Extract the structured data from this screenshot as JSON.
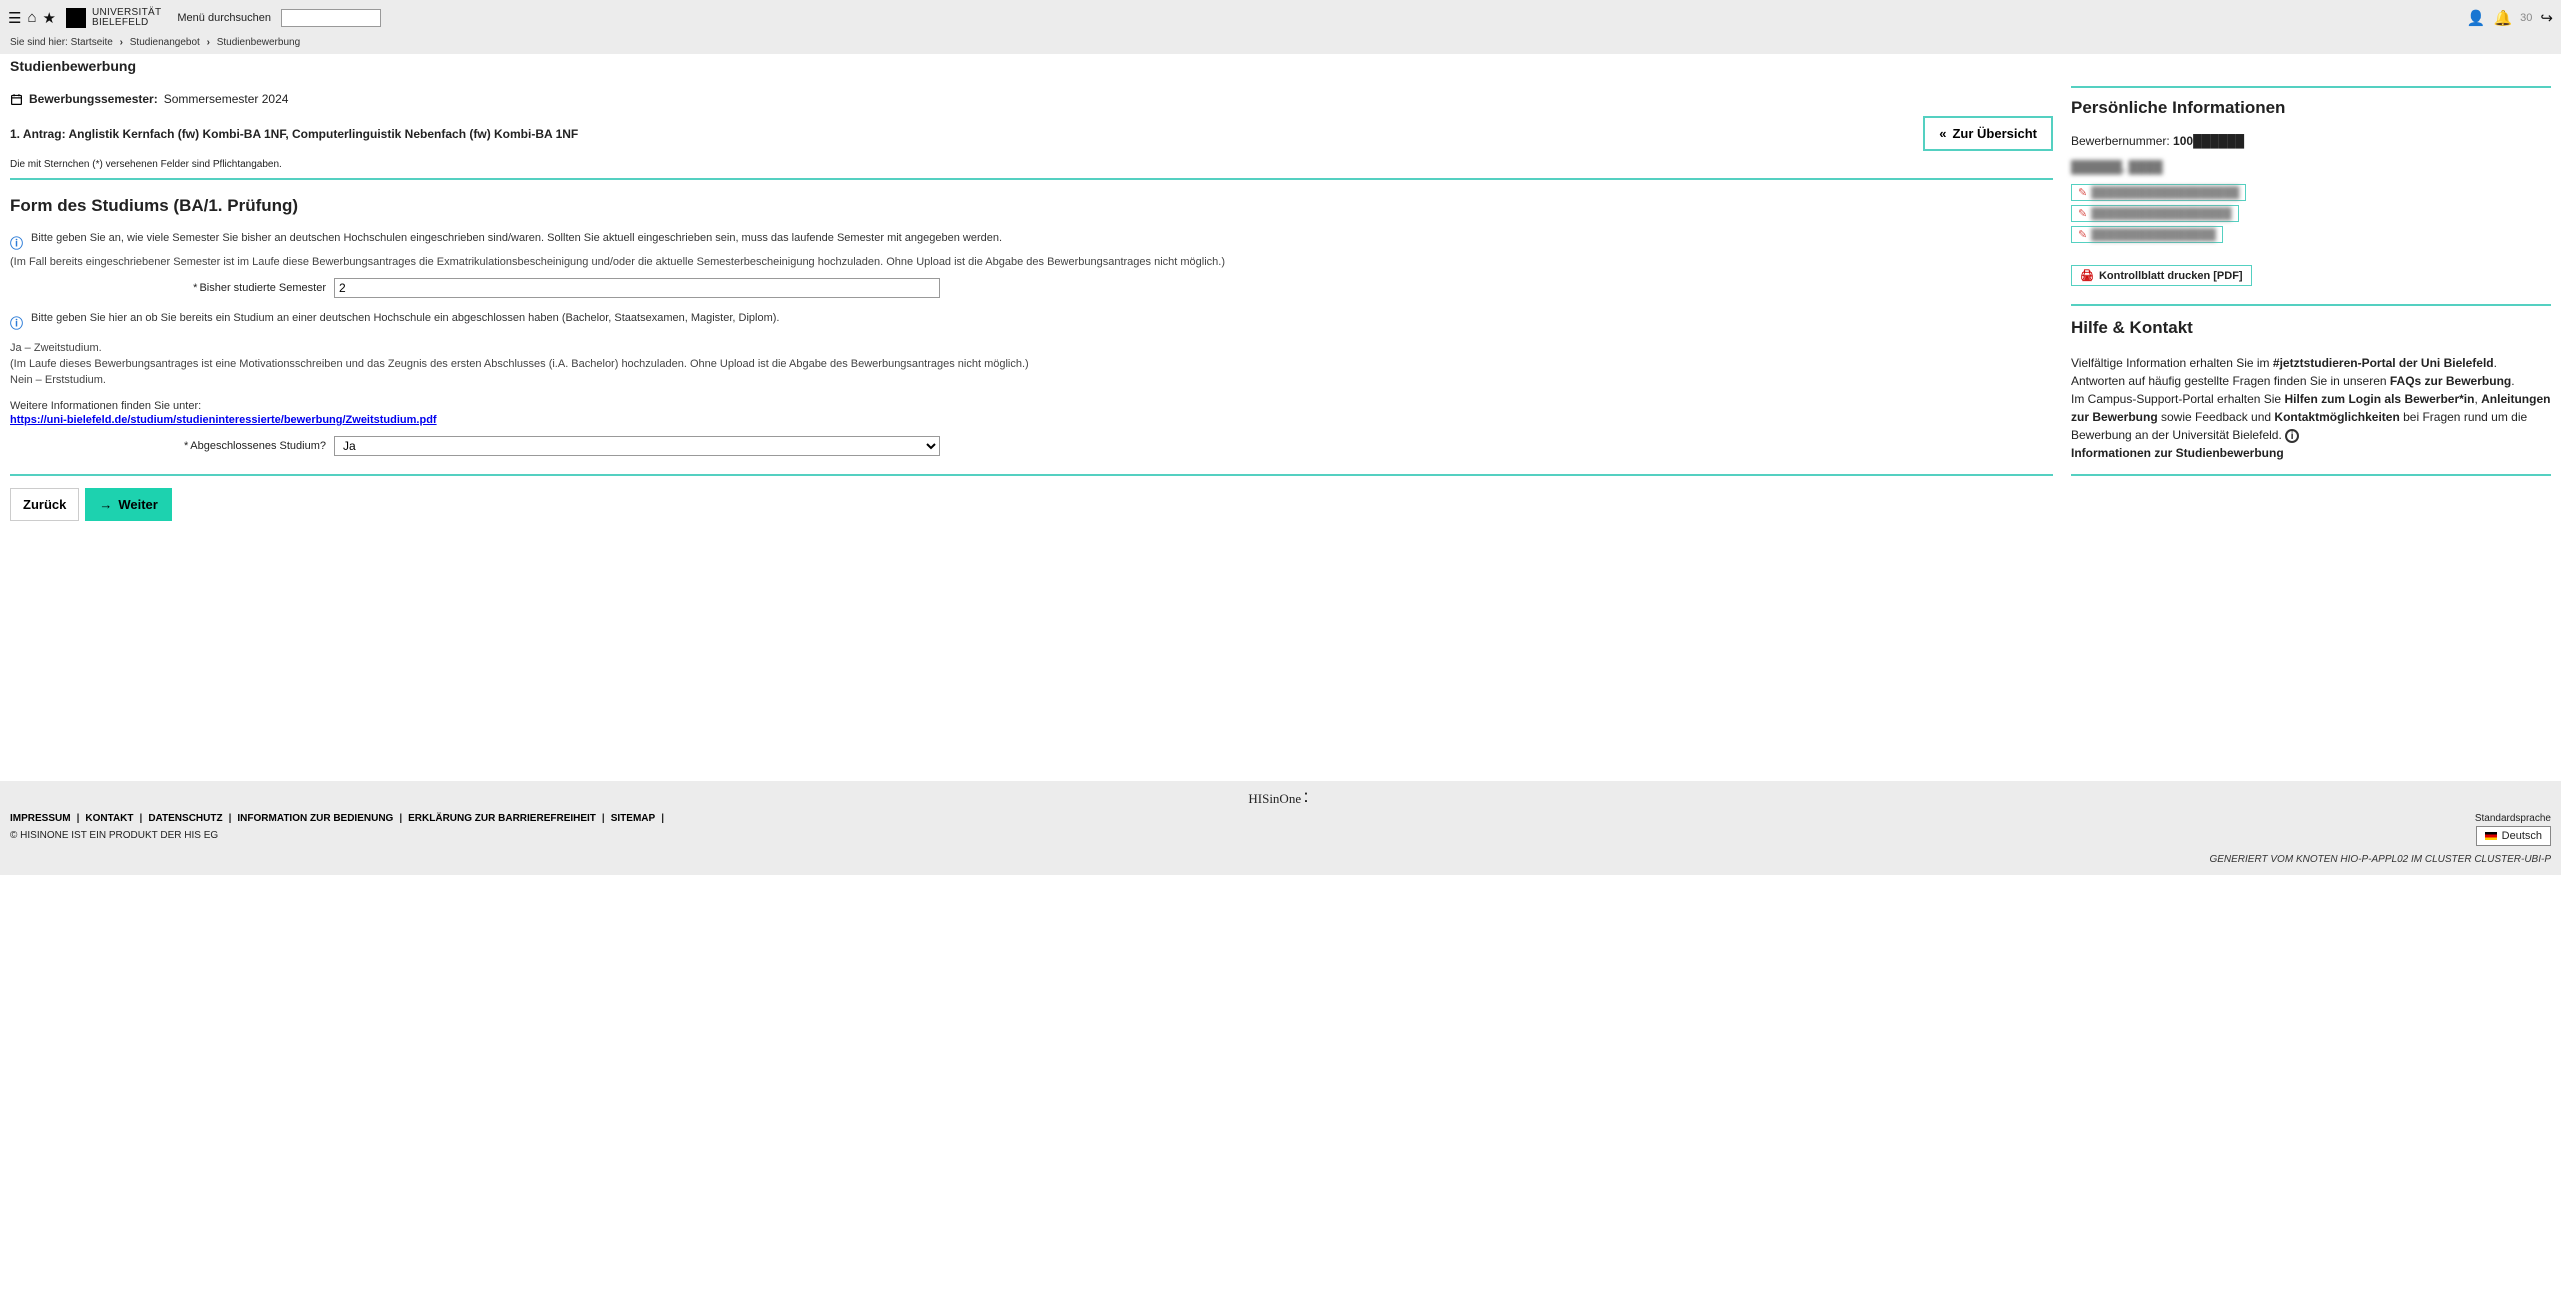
{
  "header": {
    "logo_line1": "UNIVERSITÄT",
    "logo_line2": "BIELEFELD",
    "search_label": "Menü durchsuchen",
    "notification_count": "30"
  },
  "breadcrumb": {
    "prefix": "Sie sind hier:",
    "items": [
      "Startseite",
      "Studienangebot",
      "Studienbewerbung"
    ]
  },
  "page_title": "Studienbewerbung",
  "semester": {
    "label": "Bewerbungssemester:",
    "value": "Sommersemester 2024"
  },
  "request": {
    "title": "1. Antrag: Anglistik Kernfach (fw) Kombi-BA 1NF, Computerlinguistik Nebenfach (fw) Kombi-BA 1NF",
    "overview_btn": "Zur Übersicht",
    "required_note": "Die mit Sternchen (*) versehenen Felder sind Pflichtangaben."
  },
  "section_title": "Form des Studiums (BA/1. Prüfung)",
  "info1": {
    "main": "Bitte geben Sie an, wie viele Semester Sie bisher an deutschen Hochschulen eingeschrieben sind/waren. Sollten Sie aktuell eingeschrieben sein, muss das laufende Semester mit angegeben werden.",
    "sub": "(Im Fall bereits eingeschriebener Semester ist im Laufe diese Bewerbungsantrages die Exmatrikulationsbescheinigung und/oder die aktuelle Semesterbescheinigung hochzuladen. Ohne Upload ist die Abgabe des Bewerbungsantrages nicht möglich.)"
  },
  "field_semester": {
    "label": "Bisher studierte Semester",
    "value": "2"
  },
  "info2": {
    "main": "Bitte geben Sie hier an ob Sie bereits ein Studium an einer deutschen Hochschule ein abgeschlossen haben (Bachelor, Staatsexamen, Magister, Diplom).",
    "line1": "Ja – Zweitstudium.",
    "line2": "(Im Laufe dieses Bewerbungsantrages ist eine Motivationsschreiben und das Zeugnis des ersten Abschlusses (i.A. Bachelor) hochzuladen. Ohne Upload ist die Abgabe des Bewerbungsantrages nicht möglich.)",
    "line3": "Nein – Erststudium."
  },
  "more_info_label": "Weitere Informationen finden Sie unter:",
  "more_info_link": "https://uni-bielefeld.de/studium/studieninteressierte/bewerbung/Zweitstudium.pdf",
  "field_completed": {
    "label": "Abgeschlossenes Studium?",
    "value": "Ja"
  },
  "buttons": {
    "back": "Zurück",
    "next": "Weiter"
  },
  "side": {
    "h1": "Persönliche Informationen",
    "num_label": "Bewerbernummer:",
    "num_value": "100██████",
    "name": "██████, ████",
    "edits": [
      "███████████████████",
      "██████████████████",
      "████████████████"
    ],
    "pdf_btn": "Kontrollblatt drucken [PDF]",
    "h2": "Hilfe & Kontakt",
    "help_p1a": "Vielfältige Information erhalten Sie im ",
    "help_p1b": "#jetztstudieren-Portal der Uni Bielefeld",
    "help_p1c": ".",
    "help_p2a": "Antworten auf häufig gestellte Fragen finden Sie in unseren ",
    "help_p2b": "FAQs zur Bewerbung",
    "help_p2c": ".",
    "help_p3a": "Im Campus-Support-Portal erhalten Sie ",
    "help_p3b": "Hilfen zum Login als Bewerber*in",
    "help_p3c": ", ",
    "help_p3d": "Anleitungen zur Bewerbung",
    "help_p3e": " sowie Feedback und ",
    "help_p3f": "Kontaktmöglichkeiten",
    "help_p3g": " bei Fragen rund um die Bewerbung an der Universität Bielefeld. ",
    "help_p4": "Informationen zur Studienbewerbung"
  },
  "footer": {
    "product": "HISinOne",
    "links": [
      "IMPRESSUM ",
      "KONTAKT",
      "DATENSCHUTZ",
      "INFORMATION ZUR BEDIENUNG",
      "ERKLÄRUNG ZUR BARRIEREFREIHEIT",
      "SITEMAP"
    ],
    "copy": "© HISINONE IST EIN PRODUKT DER HIS EG",
    "lang_label": "Standardsprache",
    "lang_value": "Deutsch",
    "generated": "GENERIERT VOM KNOTEN HIO-P-APPL02 IM CLUSTER CLUSTER-UBI-P"
  }
}
